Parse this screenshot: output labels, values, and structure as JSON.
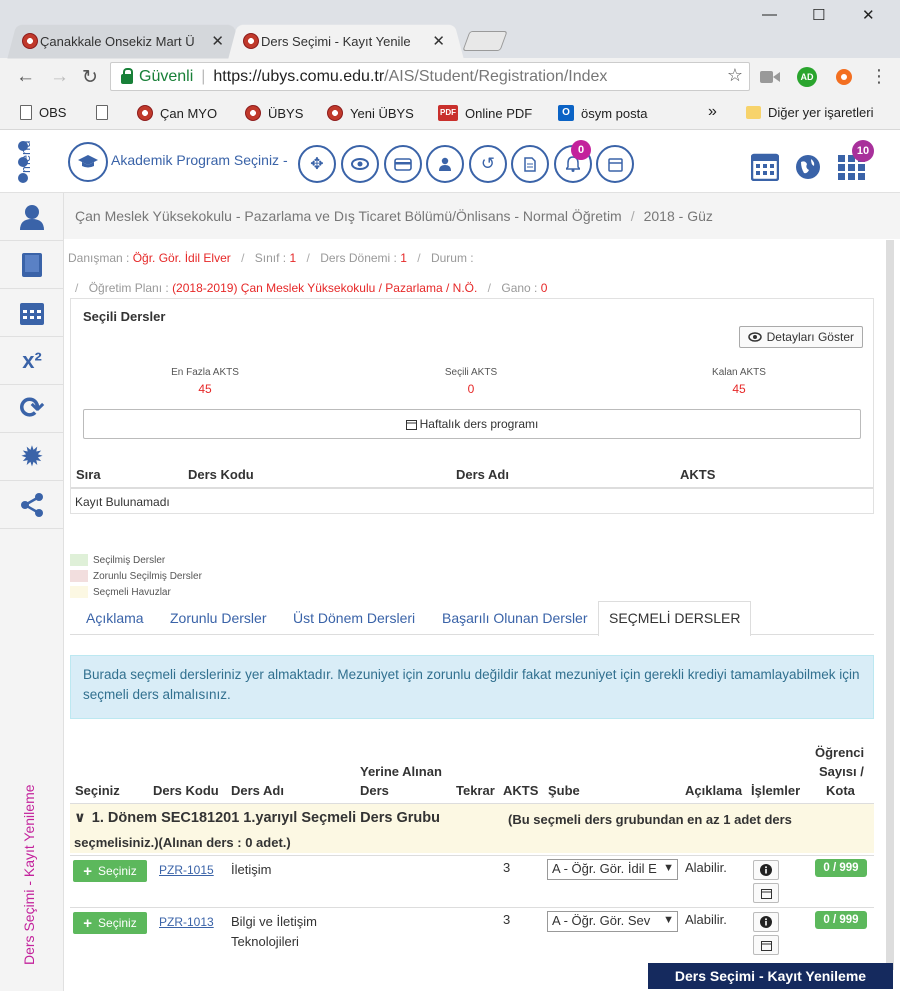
{
  "browser": {
    "tabs": [
      {
        "label": "Çanakkale Onsekiz Mart Ü"
      },
      {
        "label": "Ders Seçimi - Kayıt Yenile"
      }
    ],
    "window": {
      "minimize": "—",
      "maximize": "☐",
      "close": "✕"
    },
    "address": {
      "secure_label": "Güvenli",
      "host": "https://ubys.comu.edu.tr",
      "path": "/AIS/Student/Registration/Index"
    },
    "bookmarks": [
      {
        "label": "OBS",
        "icon": "doc-icon"
      },
      {
        "label": "",
        "icon": "doc-icon"
      },
      {
        "label": "Çan MYO",
        "icon": "comu-logo-icon"
      },
      {
        "label": "ÜBYS",
        "icon": "comu-logo-icon"
      },
      {
        "label": "Yeni ÜBYS",
        "icon": "comu-logo-icon"
      },
      {
        "label": "Online PDF",
        "icon": "pdf-icon"
      },
      {
        "label": "ösym posta",
        "icon": "outlook-icon"
      }
    ],
    "bookmarks_more": "»",
    "other_bookmarks": "Diğer yer işaretleri",
    "ext_ad_label": "AD"
  },
  "app": {
    "menu_label": "menü",
    "program_select": "Akademik Program Seçiniz -",
    "notification_count": "0",
    "apps_count": "10",
    "sidebar_vertical_label": "Ders Seçimi - Kayıt Yenileme",
    "breadcrumb": [
      "Çan Meslek Yüksekokulu - Pazarlama ve Dış Ticaret Bölümü/Önlisans - Normal Öğretim",
      "2018 - Güz"
    ],
    "info": {
      "advisor_label": "Danışman :",
      "advisor_value": "Öğr. Gör. İdil Elver",
      "class_label": "Sınıf :",
      "class_value": "1",
      "term_label": "Ders Dönemi :",
      "term_value": "1",
      "status_label": "Durum :",
      "plan_label": "Öğretim Planı :",
      "plan_value": "(2018-2019) Çan Meslek Yüksekokulu / Pazarlama / N.Ö.",
      "gano_label": "Gano :",
      "gano_value": "0"
    },
    "selected": {
      "title": "Seçili Dersler",
      "details_button": "Detayları Göster",
      "max_akts_label": "En Fazla AKTS",
      "max_akts_value": "45",
      "sel_akts_label": "Seçili AKTS",
      "sel_akts_value": "0",
      "rem_akts_label": "Kalan AKTS",
      "rem_akts_value": "45",
      "weekly_button": "Haftalık ders programı",
      "cols": [
        "Sıra",
        "Ders Kodu",
        "Ders Adı",
        "AKTS"
      ],
      "empty": "Kayıt Bulunamadı"
    },
    "legend": [
      {
        "label": "Seçilmiş Dersler",
        "color": "#dff0d8"
      },
      {
        "label": "Zorunlu Seçilmiş Dersler",
        "color": "#f2dede"
      },
      {
        "label": "Seçmeli Havuzlar",
        "color": "#fcf8e3"
      }
    ],
    "tabs": [
      "Açıklama",
      "Zorunlu Dersler",
      "Üst Dönem Dersleri",
      "Başarılı Olunan Dersler",
      "SEÇMELİ DERSLER"
    ],
    "alert": "Burada seçmeli dersleriniz yer almaktadır. Mezuniyet için zorunlu değildir fakat mezuniyet için gerekli krediyi tamamlayabilmek için seçmeli ders almalısınız.",
    "course_cols": {
      "seciniz": "Seçiniz",
      "kod": "Ders Kodu",
      "ad": "Ders Adı",
      "yerine_1": "Yerine Alınan",
      "yerine_2": "Ders",
      "tekrar": "Tekrar",
      "akts": "AKTS",
      "sube": "Şube",
      "aciklama": "Açıklama",
      "islemler": "İşlemler",
      "kota_1": "Öğrenci",
      "kota_2": "Sayısı /",
      "kota_3": "Kota"
    },
    "group": {
      "title": "1. Dönem SEC181201 1.yarıyıl Seçmeli Ders Grubu",
      "note_1": "(Bu seçmeli ders grubundan en az 1 adet ders",
      "note_2": "seçmelisiniz.)(Alınan ders : 0 adet.)"
    },
    "courses": [
      {
        "select": "Seçiniz",
        "code": "PZR-1015",
        "name": "İletişim",
        "akts": "3",
        "sube": "A - Öğr. Gör. İdil E",
        "aciklama": "Alabilir.",
        "kota": "0 / 999"
      },
      {
        "select": "Seçiniz",
        "code": "PZR-1013",
        "name": "Bilgi ve İletişim Teknolojileri",
        "akts": "3",
        "sube": "A - Öğr. Gör. Sev",
        "aciklama": "Alabilir.",
        "kota": "0 / 999"
      }
    ],
    "footer_banner": "Ders Seçimi - Kayıt Yenileme"
  }
}
